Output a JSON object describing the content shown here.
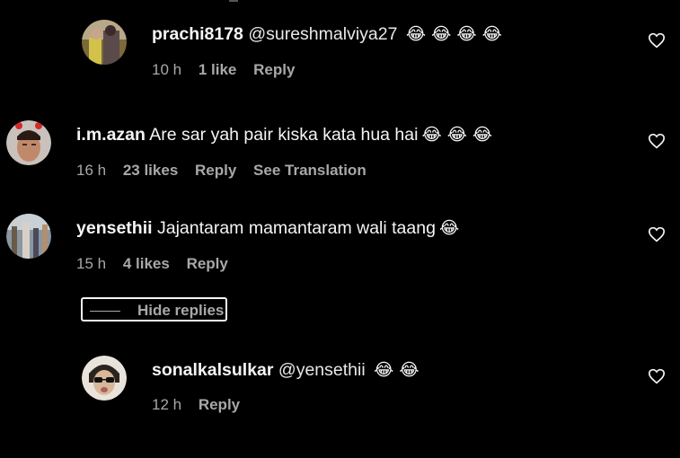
{
  "comments": [
    {
      "username": "prachi8178",
      "mention": "@sureshmalviya27",
      "text": "",
      "emojis": "😂 😂 😂 😂",
      "time": "10 h",
      "likes": "1 like",
      "reply": "Reply",
      "translation": ""
    },
    {
      "username": "i.m.azan",
      "mention": "",
      "text": "Are sar yah pair kiska kata hua hai",
      "emojis": "😂 😂 😂",
      "time": "16 h",
      "likes": "23 likes",
      "reply": "Reply",
      "translation": "See Translation"
    },
    {
      "username": "yensethii",
      "mention": "",
      "text": "Jajantaram mamantaram wali taang",
      "emojis": "😂",
      "time": "15 h",
      "likes": "4 likes",
      "reply": "Reply",
      "translation": ""
    },
    {
      "username": "sonalkalsulkar",
      "mention": "@yensethii",
      "text": "",
      "emojis": "😂 😂",
      "time": "12 h",
      "likes": "",
      "reply": "Reply",
      "translation": ""
    }
  ],
  "hide_replies_label": "Hide replies",
  "colors": {
    "background": "#000000",
    "primary_text": "#f5f5f5",
    "secondary_text": "#a8a8a8"
  }
}
